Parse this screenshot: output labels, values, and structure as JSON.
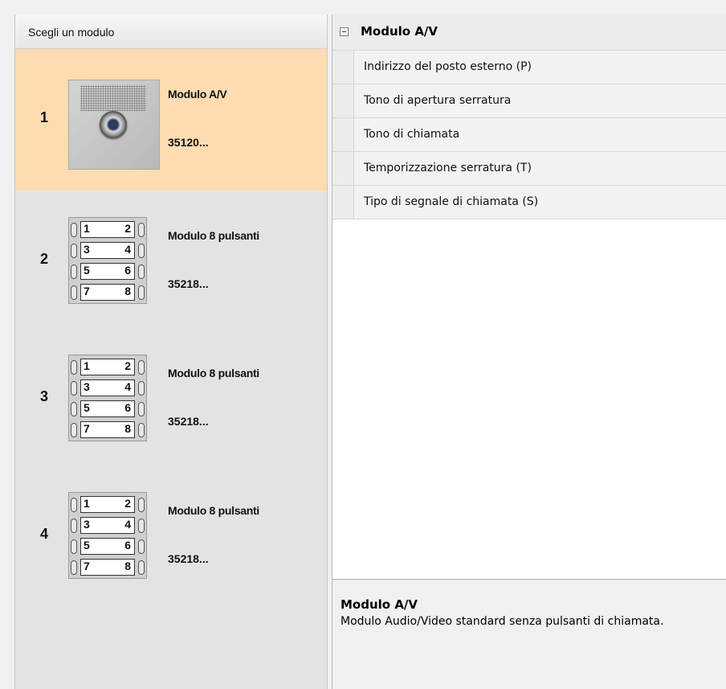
{
  "modules_panel": {
    "header": "Scegli un modulo",
    "modules": [
      {
        "number": "1",
        "name": "Modulo A/V",
        "code": "35120...",
        "selected": true,
        "thumbnail": "audio-video-module-icon"
      },
      {
        "number": "2",
        "name": "Modulo 8 pulsanti",
        "code": "35218...",
        "selected": false,
        "thumbnail": "eight-button-module-icon"
      },
      {
        "number": "3",
        "name": "Modulo 8 pulsanti",
        "code": "35218...",
        "selected": false,
        "thumbnail": "eight-button-module-icon"
      },
      {
        "number": "4",
        "name": "Modulo 8 pulsanti",
        "code": "35218...",
        "selected": false,
        "thumbnail": "eight-button-module-icon"
      }
    ],
    "button_labels": [
      [
        "1",
        "2"
      ],
      [
        "3",
        "4"
      ],
      [
        "5",
        "6"
      ],
      [
        "7",
        "8"
      ]
    ]
  },
  "properties": {
    "category": "Modulo A/V",
    "collapse_icon": "minus-box-icon",
    "items": [
      "Indirizzo del posto esterno (P)",
      "Tono di apertura serratura",
      "Tono di chiamata",
      "Temporizzazione serratura (T)",
      "Tipo di segnale di chiamata (S)"
    ]
  },
  "description": {
    "title": "Modulo A/V",
    "text": "Modulo Audio/Video standard senza pulsanti di chiamata."
  },
  "colors": {
    "selected_background": "#fcdcb0",
    "panel_background": "#e3e3e3"
  }
}
